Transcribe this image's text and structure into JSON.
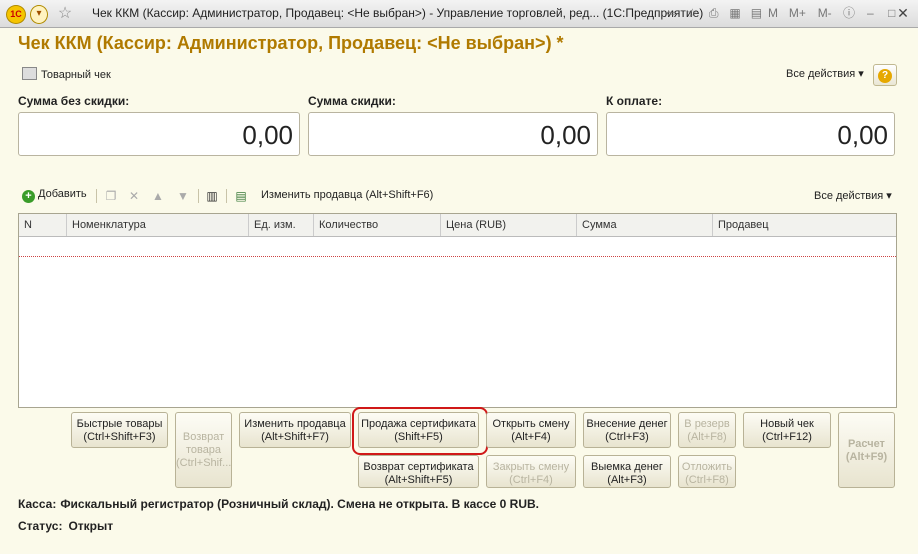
{
  "window": {
    "title": "Чек ККМ (Кассир: Администратор, Продавец: <Не выбран>) - Управление торговлей, ред...   (1С:Предприятие)",
    "logo_text": "1С",
    "tb_buttons": [
      "M",
      "M+",
      "M-"
    ]
  },
  "header": {
    "title": "Чек ККМ (Кассир: Администратор, Продавец: <Не выбран>) *",
    "print_label": "Товарный чек",
    "all_actions": "Все действия ▾",
    "help": "?"
  },
  "sums": [
    {
      "label": "Сумма без скидки:",
      "value": "0,00"
    },
    {
      "label": "Сумма скидки:",
      "value": "0,00"
    },
    {
      "label": "К оплате:",
      "value": "0,00"
    }
  ],
  "table_toolbar": {
    "add_label": "Добавить",
    "change_seller_label": "Изменить продавца (Alt+Shift+F6)",
    "all_actions": "Все действия ▾"
  },
  "table": {
    "columns": [
      "N",
      "Номенклатура",
      "Ед. изм.",
      "Количество",
      "Цена (RUB)",
      "Сумма",
      "Продавец"
    ]
  },
  "buttons": {
    "quick_goods": [
      "Быстрые товары",
      "(Ctrl+Shift+F3)"
    ],
    "return_goods": [
      "Возврат",
      "товара",
      "(Ctrl+Shif..."
    ],
    "change_seller": [
      "Изменить продавца",
      "(Alt+Shift+F7)"
    ],
    "sell_certificate": [
      "Продажа сертификата",
      "(Shift+F5)"
    ],
    "return_certificate": [
      "Возврат сертификата",
      "(Alt+Shift+F5)"
    ],
    "open_shift": [
      "Открыть смену",
      "(Alt+F4)"
    ],
    "close_shift": [
      "Закрыть смену",
      "(Ctrl+F4)"
    ],
    "deposit": [
      "Внесение денег",
      "(Ctrl+F3)"
    ],
    "withdraw": [
      "Выемка денег",
      "(Alt+F3)"
    ],
    "reserve": [
      "В резерв",
      "(Alt+F8)"
    ],
    "postpone": [
      "Отложить",
      "(Ctrl+F8)"
    ],
    "new_check": [
      "Новый чек",
      "(Ctrl+F12)"
    ],
    "payment": [
      "Расчет",
      "(Alt+F9)"
    ]
  },
  "footer": {
    "kassa_label": "Касса:",
    "kassa_value": "Фискальный регистратор (Розничный склад). Смена не открыта. В кассе 0 RUB.",
    "status_label": "Статус:",
    "status_value": "Открыт"
  },
  "colors": {
    "title": "#b07a00",
    "highlight": "#d01818",
    "background": "#fbfaea"
  }
}
